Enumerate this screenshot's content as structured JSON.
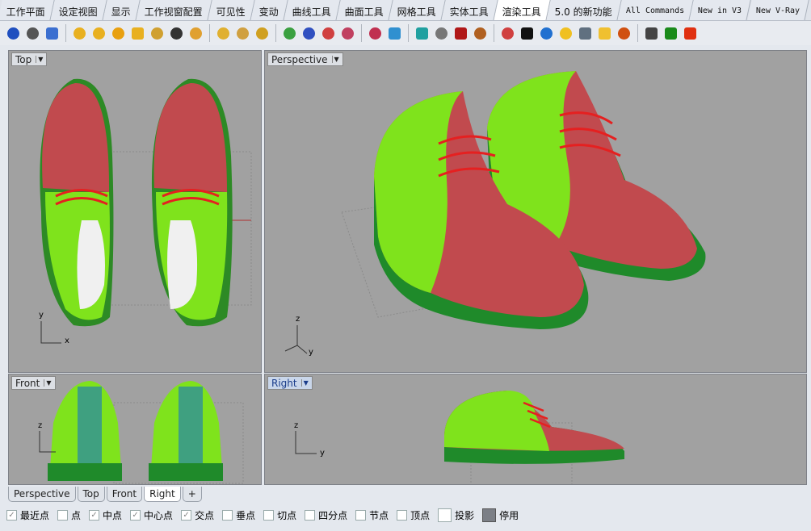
{
  "menu_tabs": [
    {
      "label": "工作平面"
    },
    {
      "label": "设定视图"
    },
    {
      "label": "显示"
    },
    {
      "label": "工作视窗配置"
    },
    {
      "label": "可见性"
    },
    {
      "label": "变动"
    },
    {
      "label": "曲线工具"
    },
    {
      "label": "曲面工具"
    },
    {
      "label": "网格工具"
    },
    {
      "label": "实体工具"
    },
    {
      "label": "渲染工具",
      "active": true
    },
    {
      "label": "5.0 的新功能"
    },
    {
      "label": "All Commands",
      "mono": true
    },
    {
      "label": "New in V3",
      "mono": true
    },
    {
      "label": "New V-Ray",
      "mono": true
    }
  ],
  "toolbar_icons": [
    {
      "name": "render-sphere-icon",
      "color": "#1f4fbf"
    },
    {
      "name": "environment-globe-icon",
      "color": "#555"
    },
    {
      "name": "save-render-icon",
      "color": "#3b6fd0",
      "sq": true
    },
    {
      "sep": true
    },
    {
      "name": "spotlight-icon",
      "color": "#e8b020"
    },
    {
      "name": "point-light-icon",
      "color": "#e8b020"
    },
    {
      "name": "directional-light-icon",
      "color": "#e8a010"
    },
    {
      "name": "rectangular-light-icon",
      "color": "#e8b020",
      "sq": true
    },
    {
      "name": "linear-light-icon",
      "color": "#d0a030"
    },
    {
      "name": "sun-light-icon",
      "color": "#333"
    },
    {
      "name": "light-edit-icon",
      "color": "#e0a030"
    },
    {
      "sep": true
    },
    {
      "name": "light-properties-icon",
      "color": "#e0b030"
    },
    {
      "name": "light-target-icon",
      "color": "#d0a040"
    },
    {
      "name": "light-hotspot-icon",
      "color": "#d0a020"
    },
    {
      "sep": true
    },
    {
      "name": "material-icon",
      "color": "#3aa040"
    },
    {
      "name": "texture-icon",
      "color": "#3050c0"
    },
    {
      "name": "decal-icon",
      "color": "#d04040"
    },
    {
      "name": "texture-mapping-icon",
      "color": "#c04060"
    },
    {
      "sep": true
    },
    {
      "name": "mesh-settings-icon",
      "color": "#c03050"
    },
    {
      "name": "color-cube-icon",
      "color": "#3090d0",
      "sq": true
    },
    {
      "sep": true
    },
    {
      "name": "box-mapping-icon",
      "color": "#20a0a0",
      "sq": true
    },
    {
      "name": "cylinder-mapping-icon",
      "color": "#777"
    },
    {
      "name": "library-icon",
      "color": "#b01818",
      "sq": true
    },
    {
      "name": "cookie-texture-icon",
      "color": "#b06020"
    },
    {
      "sep": true
    },
    {
      "name": "paint-icon",
      "color": "#d04040"
    },
    {
      "name": "checker-icon",
      "color": "#111",
      "sq": true
    },
    {
      "name": "ground-plane-icon",
      "color": "#2070d0"
    },
    {
      "name": "bulb-icon",
      "color": "#f0c020"
    },
    {
      "name": "keyboard-icon",
      "color": "#607080",
      "sq": true
    },
    {
      "name": "folder-icon",
      "color": "#f0c030",
      "sq": true
    },
    {
      "name": "explosion-icon",
      "color": "#d05010"
    },
    {
      "sep": true
    },
    {
      "name": "film-strip-icon",
      "color": "#444",
      "sq": true
    },
    {
      "name": "render-play-icon",
      "color": "#1a8a1a",
      "sq": true
    },
    {
      "name": "render-stop-icon",
      "color": "#e03010",
      "sq": true
    }
  ],
  "viewports": {
    "top": {
      "label": "Top",
      "axis_y": "y",
      "axis_x": "x"
    },
    "perspective": {
      "label": "Perspective",
      "axis_z": "z",
      "axis_y": "y"
    },
    "front": {
      "label": "Front",
      "axis_z": "z"
    },
    "right": {
      "label": "Right",
      "axis_z": "z",
      "axis_y": "y"
    }
  },
  "colors": {
    "upper": "#c14a4e",
    "quarter": "#7fe31c",
    "sole": "#1f8a2a",
    "lace": "#e52020",
    "background": "#a1a1a1"
  },
  "bottom_tabs": [
    {
      "label": "Perspective"
    },
    {
      "label": "Top"
    },
    {
      "label": "Front"
    },
    {
      "label": "Right",
      "active": true
    },
    {
      "label": "+"
    }
  ],
  "osnaps": [
    {
      "label": "最近点",
      "checked": true
    },
    {
      "label": "点",
      "checked": false
    },
    {
      "label": "中点",
      "checked": true
    },
    {
      "label": "中心点",
      "checked": true
    },
    {
      "label": "交点",
      "checked": true
    },
    {
      "label": "垂点",
      "checked": false
    },
    {
      "label": "切点",
      "checked": false
    },
    {
      "label": "四分点",
      "checked": false
    },
    {
      "label": "节点",
      "checked": false
    },
    {
      "label": "顶点",
      "checked": false
    }
  ],
  "project_label": "投影",
  "disable_label": "停用"
}
